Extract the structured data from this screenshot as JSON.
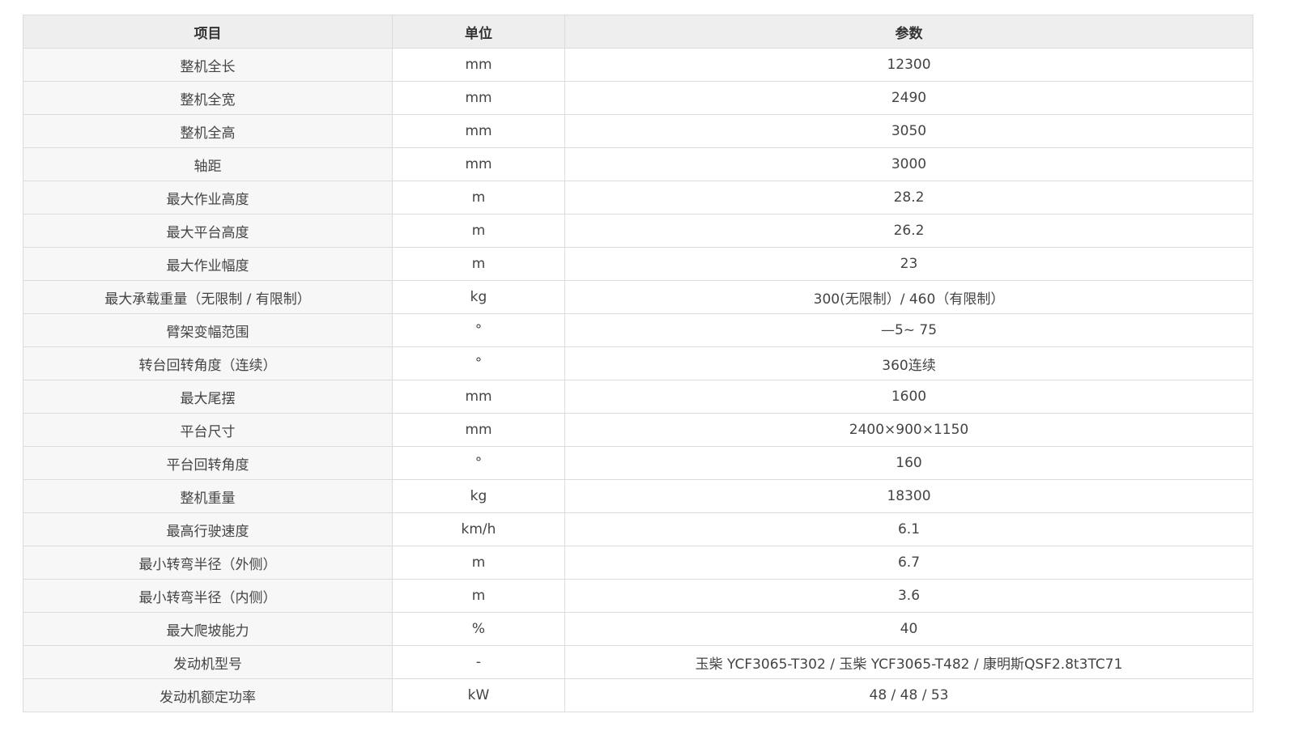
{
  "table": {
    "headers": {
      "item": "项目",
      "unit": "单位",
      "value": "参数"
    },
    "rows": [
      {
        "item": "整机全长",
        "unit": "mm",
        "value": "12300"
      },
      {
        "item": "整机全宽",
        "unit": "mm",
        "value": "2490"
      },
      {
        "item": "整机全高",
        "unit": "mm",
        "value": "3050"
      },
      {
        "item": "轴距",
        "unit": "mm",
        "value": "3000"
      },
      {
        "item": "最大作业高度",
        "unit": "m",
        "value": "28.2"
      },
      {
        "item": "最大平台高度",
        "unit": "m",
        "value": "26.2"
      },
      {
        "item": "最大作业幅度",
        "unit": "m",
        "value": "23"
      },
      {
        "item": "最大承载重量（无限制 / 有限制）",
        "unit": "kg",
        "value": "300(无限制）/ 460（有限制）"
      },
      {
        "item": "臂架变幅范围",
        "unit": "°",
        "value": "—5~ 75"
      },
      {
        "item": "转台回转角度（连续）",
        "unit": "°",
        "value": "360连续"
      },
      {
        "item": "最大尾摆",
        "unit": "mm",
        "value": "1600"
      },
      {
        "item": "平台尺寸",
        "unit": "mm",
        "value": "2400×900×1150"
      },
      {
        "item": "平台回转角度",
        "unit": "°",
        "value": "160"
      },
      {
        "item": "整机重量",
        "unit": "kg",
        "value": "18300"
      },
      {
        "item": "最高行驶速度",
        "unit": "km/h",
        "value": "6.1"
      },
      {
        "item": "最小转弯半径（外侧）",
        "unit": "m",
        "value": "6.7"
      },
      {
        "item": "最小转弯半径（内侧）",
        "unit": "m",
        "value": "3.6"
      },
      {
        "item": "最大爬坡能力",
        "unit": "%",
        "value": "40"
      },
      {
        "item": "发动机型号",
        "unit": "-",
        "value": "玉柴 YCF3065-T302 / 玉柴 YCF3065-T482 / 康明斯QSF2.8t3TC71"
      },
      {
        "item": "发动机额定功率",
        "unit": "kW",
        "value": "48 / 48 / 53"
      }
    ]
  }
}
